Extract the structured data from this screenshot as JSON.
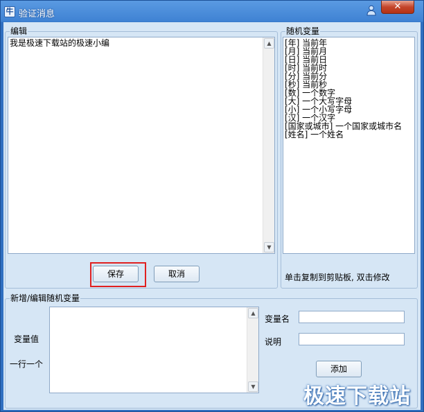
{
  "window": {
    "title": "验证消息",
    "app_icon_glyph": "牛",
    "close_glyph": "✕"
  },
  "editor": {
    "legend": "编辑",
    "content": "我是极速下载站的极速小编"
  },
  "buttons": {
    "save": "保存",
    "cancel": "取消",
    "add": "添加"
  },
  "random_vars": {
    "legend": "随机变量",
    "items": [
      "[年]   当前年",
      "[月]   当前月",
      "[日]   当前日",
      "[时]   当前时",
      "[分]   当前分",
      "[秒]   当前秒",
      "[数]   一个数字",
      "[大]   一个大写字母",
      "[小]   一个小写字母",
      "[汉]   一个汉字",
      "[国家或城市]   一个国家或城市名",
      "[姓名]   一个姓名"
    ],
    "hint": "单击复制到剪贴板, 双击修改"
  },
  "new_var": {
    "legend": "新增/编辑随机变量",
    "value_label": "变量值",
    "value_hint": "一行一个",
    "name_label": "变量名",
    "desc_label": "说明",
    "name_value": "",
    "desc_value": ""
  },
  "watermark": "极速下载站",
  "colors": {
    "title_bar": "#3f82d3",
    "client_bg": "#d6e6f5",
    "highlight": "#e02020"
  }
}
